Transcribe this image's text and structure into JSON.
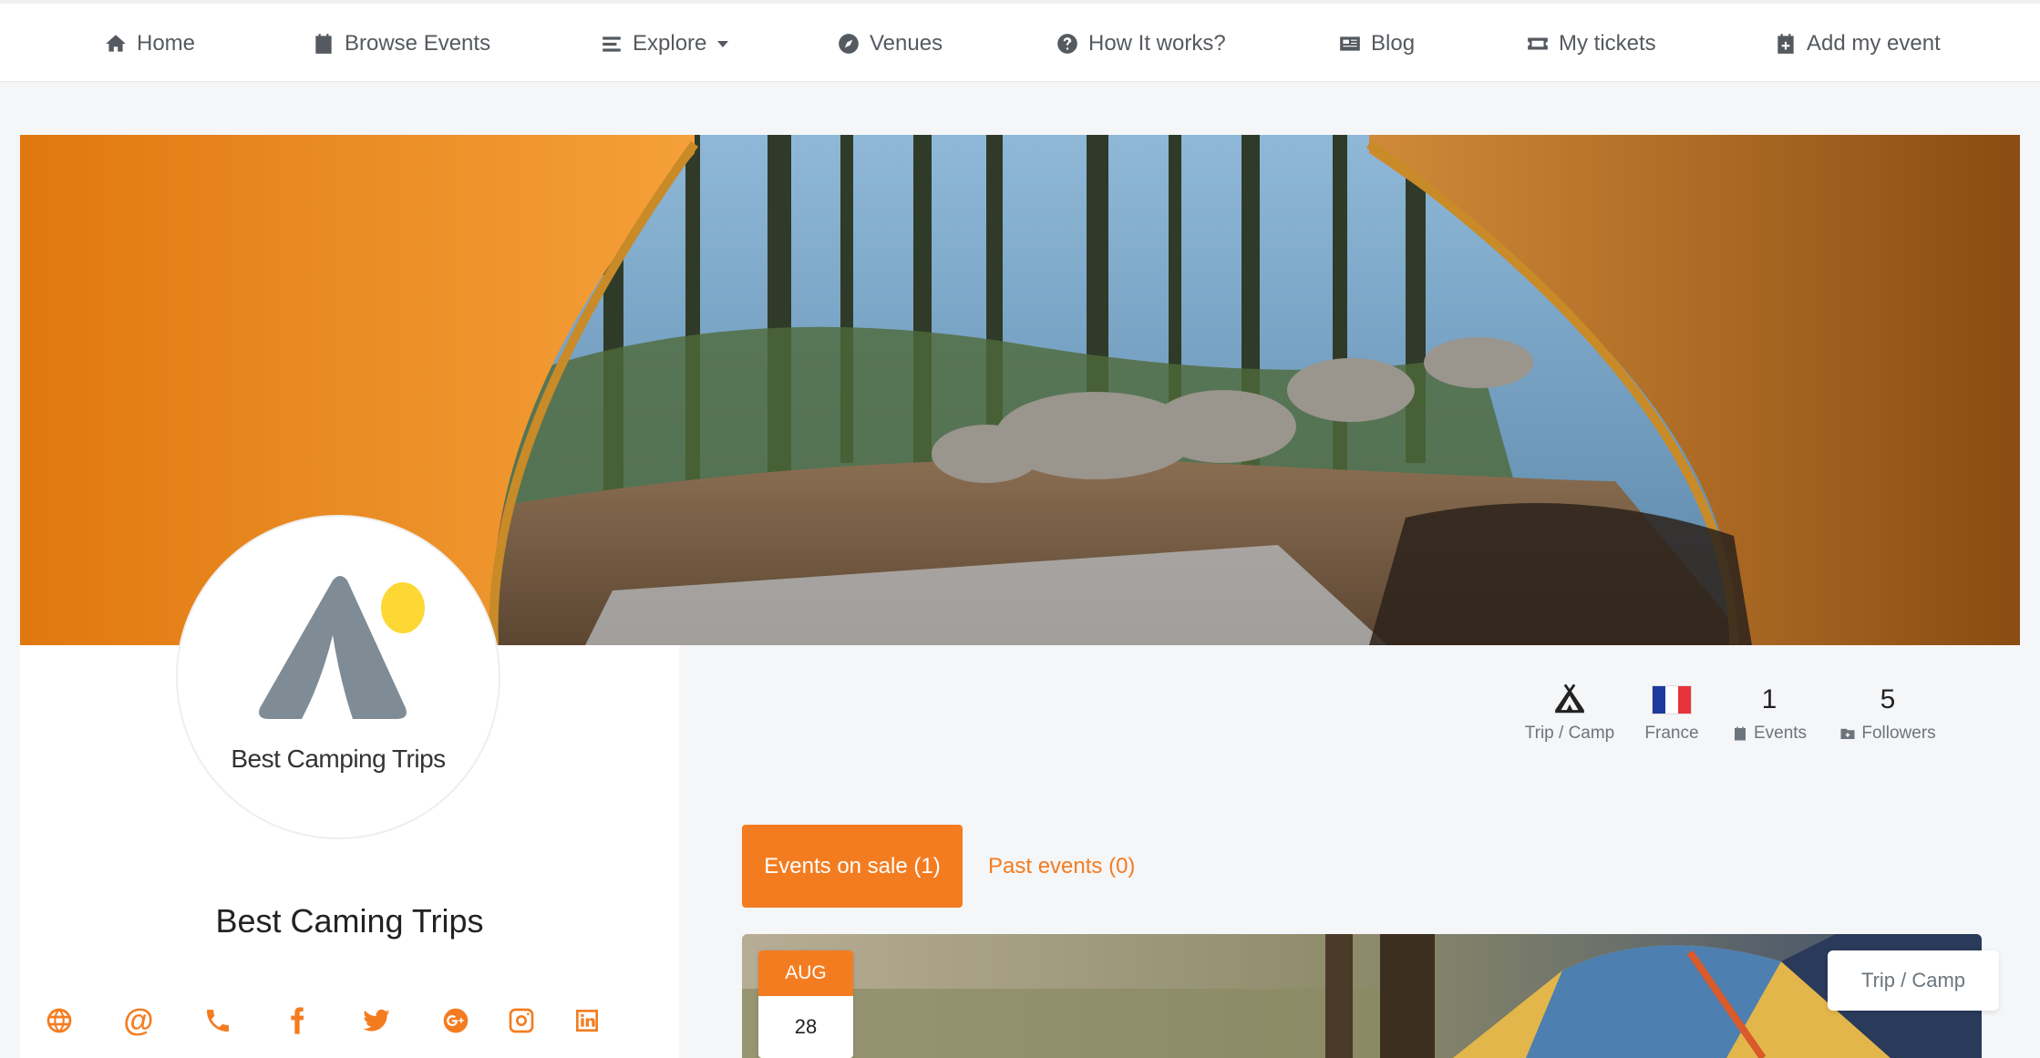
{
  "nav": {
    "home": "Home",
    "browse_events": "Browse Events",
    "explore": "Explore",
    "venues": "Venues",
    "how_it_works": "How It works?",
    "blog": "Blog",
    "my_tickets": "My tickets",
    "add_event": "Add my event"
  },
  "organizer": {
    "logo_text": "Best Camping Trips",
    "name": "Best Caming Trips",
    "stats": {
      "category": "Trip / Camp",
      "country": "France",
      "events_count": "1",
      "events_label": "Events",
      "followers_count": "5",
      "followers_label": "Followers"
    }
  },
  "tabs": {
    "on_sale": "Events on sale (1)",
    "past": "Past events (0)"
  },
  "event": {
    "month": "AUG",
    "day": "28",
    "category": "Trip / Camp"
  },
  "colors": {
    "accent": "#f47c20",
    "flag_blue": "#1f3a9e",
    "flag_white": "#ffffff",
    "flag_red": "#e8333b"
  }
}
